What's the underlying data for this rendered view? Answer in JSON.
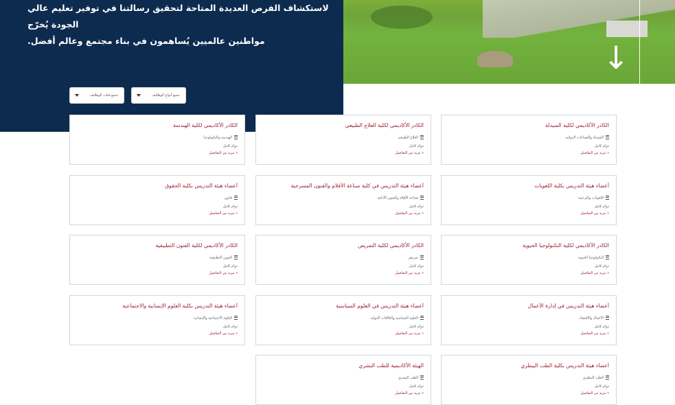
{
  "hero": {
    "line1": "لاستكشاف الفرص العديدة المتاحة لتحقيق رسالتنا في توفير تعليم عالي الجودة يُخرّج",
    "line2": "مواطنين عالميين يُساهمون في بناء مجتمع وعالم أفضل.",
    "scroll_icon": "arrow-down-icon",
    "scroll_glyph": "↓"
  },
  "filters": [
    {
      "label": "جميع فئات الوظائف"
    },
    {
      "label": "جميع أنواع الوظائف"
    }
  ],
  "colors": {
    "navy": "#0d2b4f",
    "title_red": "#9b1b2e"
  },
  "cards": [
    {
      "title": "الكادر الأكاديمي لكلية الصيدلة",
      "category": "الصيدلة والصناعات الدوائية",
      "type": "دوام كامل",
      "more": "« مزيد من التفاصيل"
    },
    {
      "title": "الكادر الأكاديمي لكلية العلاج الطبيعي",
      "category": "العلاج الطبيعي",
      "type": "دوام كامل",
      "more": "« مزيد من التفاصيل"
    },
    {
      "title": "الكادر الأكاديمي لكلية الهندسة",
      "category": "الهندسة والتكنولوجيا",
      "type": "دوام كامل",
      "more": "« مزيد من التفاصيل"
    },
    {
      "title": "أعضاء هيئة التدريس بكلية اللغويات",
      "category": "اللغويات والترجمة",
      "type": "دوام كامل",
      "more": "« مزيد من التفاصيل"
    },
    {
      "title": "أعضاء هيئة التدريس في كلية صناعة الأفلام والفنون المسرحية",
      "category": "صناعة الأفلام والفنون الأدائية",
      "type": "دوام كامل",
      "more": "« مزيد من التفاصيل"
    },
    {
      "title": "أعضاء هيئة التدريس بكلية الحقوق",
      "category": "قانون",
      "type": "دوام كامل",
      "more": "« مزيد من التفاصيل"
    },
    {
      "title": "الكادر الأكاديمي لكلية التكنولوجيا الحيوية",
      "category": "التكنولوجيا الحيوية",
      "type": "دوام كامل",
      "more": "« مزيد من التفاصيل"
    },
    {
      "title": "الكادر الأكاديمي لكلية التمريض",
      "category": "تمريض",
      "type": "دوام كامل",
      "more": "« مزيد من التفاصيل"
    },
    {
      "title": "الكادر الأكاديمي لكلية الفنون التطبيقية",
      "category": "الفنون التطبيقية",
      "type": "دوام كامل",
      "more": "« مزيد من التفاصيل"
    },
    {
      "title": "أعضاء هيئة التدريس في إدارة الأعمال",
      "category": "الأعمال والاقتصاد",
      "type": "دوام كامل",
      "more": "« مزيد من التفاصيل"
    },
    {
      "title": "أعضاء هيئة التدريس في العلوم السياسية",
      "category": "العلوم السياسية والعلاقات الدولية",
      "type": "دوام كامل",
      "more": "« مزيد من التفاصيل"
    },
    {
      "title": "أعضاء هيئة التدريس بكلية العلوم الإنسانية والاجتماعية",
      "category": "العلوم الاجتماعية والإنسانية",
      "type": "دوام كامل",
      "more": "« مزيد من التفاصيل"
    },
    {
      "title": "أعضاء هيئة التدريس بكلية الطب البيطري",
      "category": "الطب البيطري",
      "type": "دوام كامل",
      "more": "« مزيد من التفاصيل"
    },
    {
      "title": "الهيئة الأكاديمية للطب البشري",
      "category": "الطب البشري",
      "type": "دوام كامل",
      "more": "« مزيد من التفاصيل"
    }
  ]
}
